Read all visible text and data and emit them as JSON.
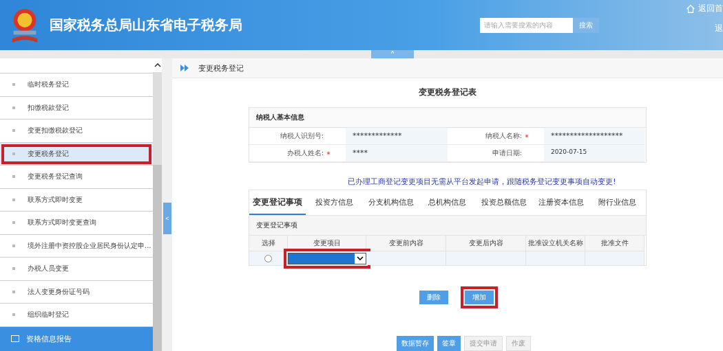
{
  "header": {
    "title": "国家税务总局山东省电子税务局",
    "search": {
      "placeholder": "请输入需要搜索的内容",
      "button": "搜索"
    },
    "links": [
      "返回首",
      "退"
    ],
    "collapse_toggle": "^"
  },
  "sidebar": {
    "items": [
      {
        "label": "临时税务登记",
        "selected": false,
        "annotated": false
      },
      {
        "label": "扣缴税款登记",
        "selected": false,
        "annotated": false
      },
      {
        "label": "变更扣缴税款登记",
        "selected": false,
        "annotated": false
      },
      {
        "label": "变更税务登记",
        "selected": true,
        "annotated": true
      },
      {
        "label": "变更税务登记查询",
        "selected": false,
        "annotated": false
      },
      {
        "label": "联系方式即时变更",
        "selected": false,
        "annotated": false
      },
      {
        "label": "联系方式即时变更查询",
        "selected": false,
        "annotated": false
      },
      {
        "label": "境外注册中资控股企业居民身份认定申...",
        "selected": false,
        "annotated": false
      },
      {
        "label": "办税人员变更",
        "selected": false,
        "annotated": false
      },
      {
        "label": "法人变更身份证号码",
        "selected": false,
        "annotated": false
      },
      {
        "label": "组织临时登记",
        "selected": false,
        "annotated": false
      }
    ],
    "section": "资格信息报告",
    "collapse_toggle": "<"
  },
  "breadcrumb": "变更税务登记",
  "form": {
    "title": "变更税务登记表",
    "info_title": "纳税人基本信息",
    "fields": [
      {
        "label": "纳税人识别号:",
        "required": false,
        "value": "*************"
      },
      {
        "label": "纳税人名称:",
        "required": true,
        "value": "*******************"
      },
      {
        "label": "办税人姓名:",
        "required": true,
        "value": "****"
      },
      {
        "label": "申请日期:",
        "required": false,
        "value": "2020-07-15"
      }
    ],
    "notice": "已办理工商登记变更项目无需从平台发起申请，跟随税务登记变更事项自动变更!",
    "tabs": [
      {
        "label": "变更登记事项",
        "selected": true
      },
      {
        "label": "投资方信息",
        "selected": false
      },
      {
        "label": "分支机构信息",
        "selected": false
      },
      {
        "label": "总机构信息",
        "selected": false
      },
      {
        "label": "投资总额信息",
        "selected": false
      },
      {
        "label": "注册资本信息",
        "selected": false
      },
      {
        "label": "附行业信息",
        "selected": false
      }
    ],
    "table": {
      "title": "变更登记事项",
      "columns": [
        "选择",
        "变更项目",
        "变更前内容",
        "变更后内容",
        "批准设立机关名称",
        "批准文件"
      ],
      "rows": [
        {
          "selected": false,
          "dropdown_annotated": true
        }
      ]
    },
    "row_buttons": [
      {
        "label": "删除",
        "annotated": false
      },
      {
        "label": "增加",
        "annotated": true
      }
    ],
    "actions": [
      {
        "label": "数据暂存",
        "disabled": false
      },
      {
        "label": "签章",
        "disabled": false
      },
      {
        "label": "提交申请",
        "disabled": true
      },
      {
        "label": "作废",
        "disabled": true
      }
    ]
  }
}
